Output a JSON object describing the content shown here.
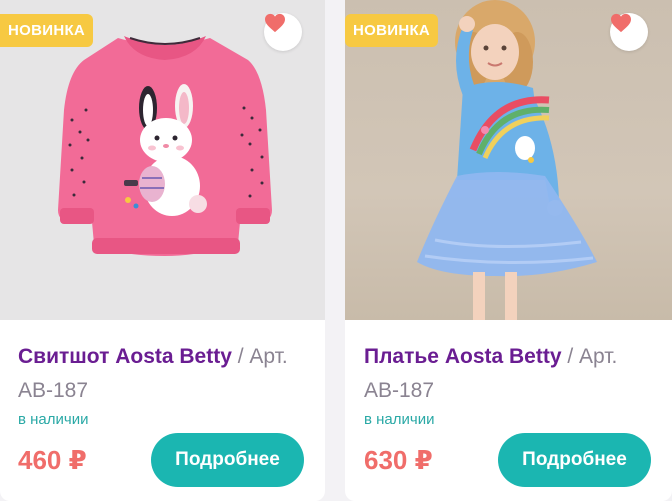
{
  "products": [
    {
      "badge": "НОВИНКА",
      "name": "Свитшот Aosta Betty",
      "separator": " / ",
      "art": "Арт. АВ-187",
      "stock": "в наличии",
      "price": "460 ₽",
      "button": "Подробнее",
      "image": "pink-sweatshirt-with-bunny-illustration"
    },
    {
      "badge": "НОВИНКА",
      "name": "Платье Aosta Betty",
      "separator": " / ",
      "art": "Арт. АВ-187",
      "stock": "в наличии",
      "price": "630 ₽",
      "button": "Подробнее",
      "image": "girl-in-blue-dress-with-rainbow-and-tulle-skirt"
    }
  ],
  "colors": {
    "badge": "#f7c942",
    "title": "#6a1d92",
    "stock": "#2aa9a6",
    "price": "#f06d6a",
    "button": "#1bb6b1",
    "heart": "#f06d6a"
  },
  "icons": {
    "favorite": "heart-icon"
  }
}
